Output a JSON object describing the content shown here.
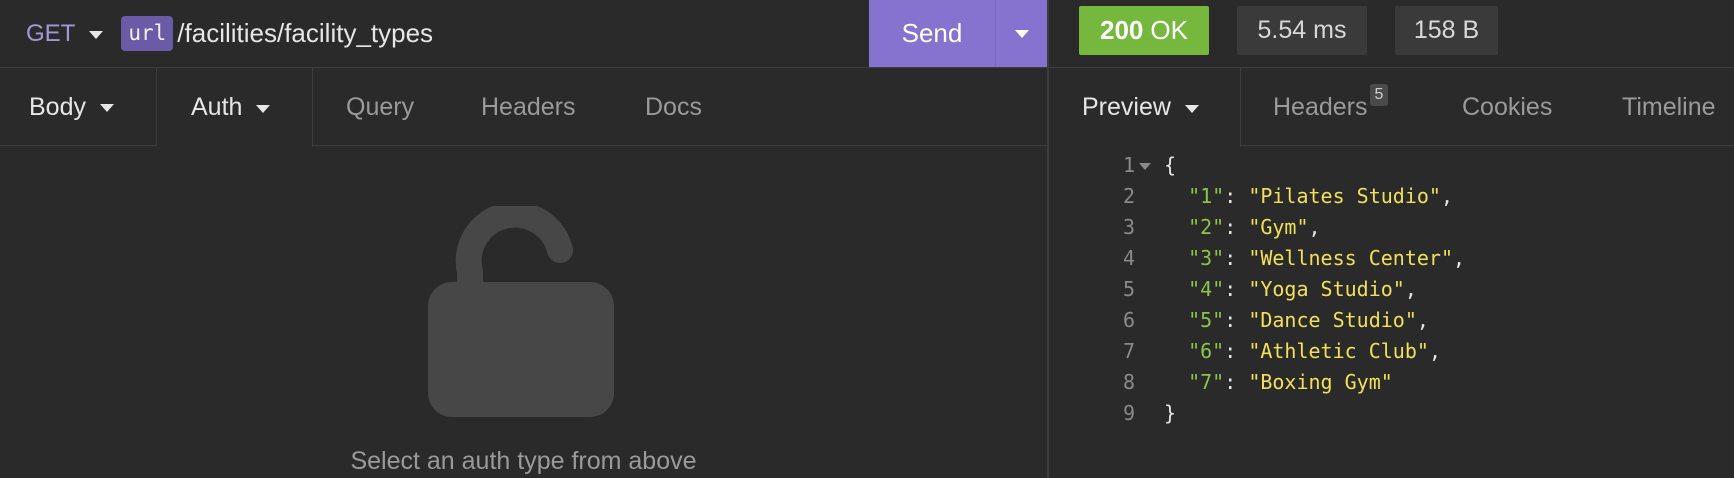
{
  "request": {
    "method": "GET",
    "url_variable": "url",
    "url_path": "/facilities/facility_types",
    "send_label": "Send"
  },
  "response": {
    "status_code": "200",
    "status_text": "OK",
    "time": "5.54 ms",
    "size": "158 B"
  },
  "request_tabs": {
    "body": "Body",
    "auth": "Auth",
    "query": "Query",
    "headers": "Headers",
    "docs": "Docs"
  },
  "response_tabs": {
    "preview": "Preview",
    "headers": "Headers",
    "headers_count": "5",
    "cookies": "Cookies",
    "timeline": "Timeline"
  },
  "auth_empty": {
    "hint": "Select an auth type from above",
    "icon": "unlocked-padlock-icon"
  },
  "preview_lines": [
    {
      "n": "1",
      "open": "{"
    },
    {
      "n": "2",
      "key": "\"1\"",
      "value": "\"Pilates Studio\"",
      "comma": ","
    },
    {
      "n": "3",
      "key": "\"2\"",
      "value": "\"Gym\"",
      "comma": ","
    },
    {
      "n": "4",
      "key": "\"3\"",
      "value": "\"Wellness Center\"",
      "comma": ","
    },
    {
      "n": "5",
      "key": "\"4\"",
      "value": "\"Yoga Studio\"",
      "comma": ","
    },
    {
      "n": "6",
      "key": "\"5\"",
      "value": "\"Dance Studio\"",
      "comma": ","
    },
    {
      "n": "7",
      "key": "\"6\"",
      "value": "\"Athletic Club\"",
      "comma": ","
    },
    {
      "n": "8",
      "key": "\"7\"",
      "value": "\"Boxing Gym\"",
      "comma": ""
    },
    {
      "n": "9",
      "close": "}"
    }
  ],
  "colors": {
    "accent": "#8673cf",
    "status_ok": "#75b83d",
    "json_key": "#8cc34a",
    "json_string": "#f0e05a"
  }
}
